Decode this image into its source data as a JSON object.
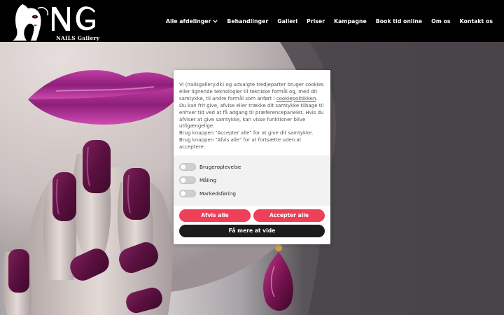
{
  "header": {
    "logo_text": "NAILS Gallery",
    "nav": [
      {
        "label": "Alle afdelinger",
        "has_dropdown": true
      },
      {
        "label": "Behandlinger"
      },
      {
        "label": "Galleri"
      },
      {
        "label": "Priser"
      },
      {
        "label": "Kampagne"
      },
      {
        "label": "Book tid online"
      },
      {
        "label": "Om os"
      },
      {
        "label": "Kontakt os"
      }
    ]
  },
  "cookie": {
    "paragraph1_before_link": "Vi (nailsgallery.dk) og udvalgte tredjeparter bruger cookies eller lignende teknologier til tekniske formål og, med dit samtykke, til andre formål som anført i ",
    "link": "cookiepolitikken",
    "paragraph1_after_link": ".",
    "paragraph2": "Du kan frit give, afvise eller trække dit samtykke tilbage til enhver tid ved at få adgang til præferencepanelet. Hvis du afviser at give samtykke, kan visse funktioner blive utilgængelige.",
    "paragraph3": "Brug knappen \"Accepter alle\" for at give dit samtykke. Brug knappen \"Afvis alle\" for at fortsætte uden at acceptere.",
    "options": [
      {
        "label": "Brugeroplevelse",
        "enabled": false
      },
      {
        "label": "Måling",
        "enabled": false
      },
      {
        "label": "Markedsføring",
        "enabled": false
      }
    ],
    "reject_label": "Afvis alle",
    "accept_label": "Accepter alle",
    "more_label": "Få mere at vide"
  },
  "colors": {
    "accent": "#ee4058",
    "dark_button": "#1c1c1c",
    "nail_polish": "#5d1240",
    "header_bg": "#000000"
  }
}
